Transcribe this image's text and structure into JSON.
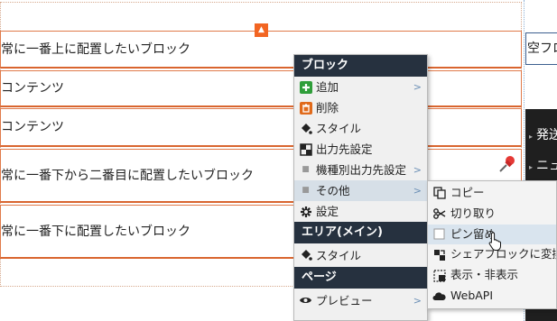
{
  "editor": {
    "blocks": [
      {
        "text": "常に一番上に配置したいブロック"
      },
      {
        "text": "コンテンツ"
      },
      {
        "text": "コンテンツ"
      },
      {
        "text": "常に一番下から二番目に配置したいブロック"
      },
      {
        "text": "常に一番下に配置したいブロック"
      }
    ],
    "right_column": {
      "box_text": "空フロ",
      "nav_items": [
        "発送",
        "ニュ"
      ]
    }
  },
  "context_menu": {
    "block_section": "ブロック",
    "block_items": {
      "add": "追加",
      "delete": "削除",
      "style": "スタイル",
      "output": "出力先設定",
      "device_output": "機種別出力先設定",
      "other": "その他",
      "settings": "設定"
    },
    "area_section": "エリア(メイン)",
    "area_items": {
      "style": "スタイル"
    },
    "page_section": "ページ",
    "page_items": {
      "preview": "プレビュー"
    },
    "submenu_arrow": ">"
  },
  "submenu": {
    "copy": "コピー",
    "cut": "切り取り",
    "pin": "ピン留め",
    "share_convert": "シェアブロックに変換",
    "toggle_visibility": "表示・非表示",
    "webapi": "WebAPI"
  },
  "colors": {
    "block_border": "#e07a4a",
    "menu_header": "#26313f",
    "add_icon": "#2f9e3a",
    "delete_icon": "#e06a1b",
    "arrow": "#6b8fb5"
  }
}
